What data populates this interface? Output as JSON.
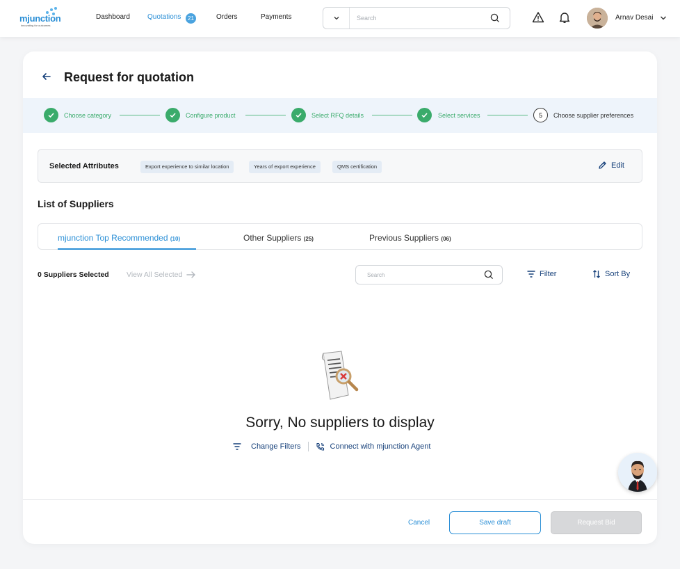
{
  "brand": {
    "name": "mjunction",
    "tagline": "innovating for outcomes"
  },
  "nav": {
    "items": [
      {
        "label": "Dashboard"
      },
      {
        "label": "Quotations",
        "badge": "21"
      },
      {
        "label": "Orders"
      },
      {
        "label": "Payments"
      }
    ]
  },
  "header": {
    "search_placeholder": "Search",
    "user_name": "Arnav Desai"
  },
  "page": {
    "title": "Request for quotation"
  },
  "stepper": {
    "steps": [
      {
        "label": "Choose category",
        "status": "done"
      },
      {
        "label": "Configure product",
        "status": "done"
      },
      {
        "label": "Select RFQ details",
        "status": "done"
      },
      {
        "label": "Select services",
        "status": "done"
      },
      {
        "label": "Choose supplier preferences",
        "status": "current",
        "number": "5"
      }
    ]
  },
  "attributes": {
    "title": "Selected Attributes",
    "chips": [
      "Export experience to similar location",
      "Years of export experience",
      "QMS certification"
    ],
    "edit_label": "Edit"
  },
  "suppliers": {
    "title": "List of Suppliers",
    "tabs": [
      {
        "label": "mjunction Top Recommended",
        "count": "(10)"
      },
      {
        "label": "Other Suppliers",
        "count": "(25)"
      },
      {
        "label": "Previous Suppliers",
        "count": "(06)"
      }
    ],
    "selected_count": "0 Suppliers Selected",
    "view_all": "View All Selected",
    "search_placeholder": "Search",
    "filter_label": "Filter",
    "sort_label": "Sort By"
  },
  "empty": {
    "title": "Sorry, No suppliers to display",
    "change_filters": "Change Filters",
    "connect_agent": "Connect with mjunction Agent"
  },
  "footer": {
    "cancel": "Cancel",
    "save_draft": "Save draft",
    "request_bid": "Request Bid"
  },
  "colors": {
    "accent": "#2b8fd6",
    "success": "#3aab6b",
    "navy": "#16407a",
    "disabled": "#d7d8da"
  }
}
